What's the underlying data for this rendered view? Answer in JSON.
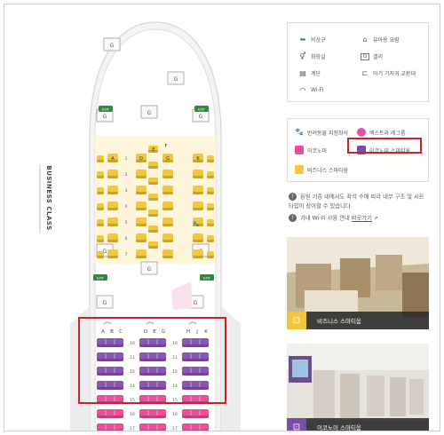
{
  "legend": {
    "items": [
      {
        "icon": "exit-arrow-icon",
        "label": "비상구"
      },
      {
        "icon": "baby-bassinet-icon",
        "label": "유아용 요람"
      },
      {
        "icon": "restroom-icon",
        "label": "화장실"
      },
      {
        "icon": "galley-icon",
        "label": "갤리"
      },
      {
        "icon": "stairs-icon",
        "label": "계단"
      },
      {
        "icon": "diaper-table-icon",
        "label": "아기 기저귀 교환대"
      },
      {
        "icon": "wifi-icon",
        "label": "Wi-Fi"
      }
    ]
  },
  "legend2": {
    "items": [
      {
        "label": "반려동물 지정좌석",
        "color": "#d9b24a"
      },
      {
        "label": "엑스트라 레그룸",
        "color": "#e052a2"
      },
      {
        "label": "이코노미",
        "color": "#e8509b"
      },
      {
        "label": "이코노미 스마티움",
        "color": "#7b4ea6"
      },
      {
        "label": "비즈니스 스마티움",
        "color": "#f3c73a"
      }
    ]
  },
  "notes": {
    "note1": "동일 기종 내에서도 좌석 수에 따라 내부 구조 및 시트 타입이 상이할 수 있습니다.",
    "note2_prefix": "기내 Wi-Fi 사용 안내 ",
    "note2_link": "바로가기"
  },
  "photos": {
    "business_caption": "비즈니스 스마티움",
    "economy_caption": "이코노미 스마티움"
  },
  "plane": {
    "business_label": "BUSINESS CLASS",
    "galley_label": "G",
    "exit_label": "EXIT",
    "business_cols": [
      "A",
      "D",
      "G",
      "K"
    ],
    "business_cols_mid": [
      "E",
      "F"
    ],
    "business_rows": [
      "1",
      "2",
      "3",
      "4",
      "5",
      "6",
      "7"
    ],
    "economy_cols": [
      "A",
      "B",
      "C",
      "D",
      "E",
      "G",
      "H",
      "J",
      "K"
    ],
    "economy_rows": [
      "10",
      "11",
      "12",
      "14",
      "15",
      "16",
      "17"
    ],
    "colors": {
      "business": "#f3c73a",
      "smartium": "#8a55b5",
      "economy": "#e8509b",
      "fuselage": "#ffffff",
      "fuselage_outline": "#c9c9c9",
      "exit": "#2e8b3a"
    }
  }
}
